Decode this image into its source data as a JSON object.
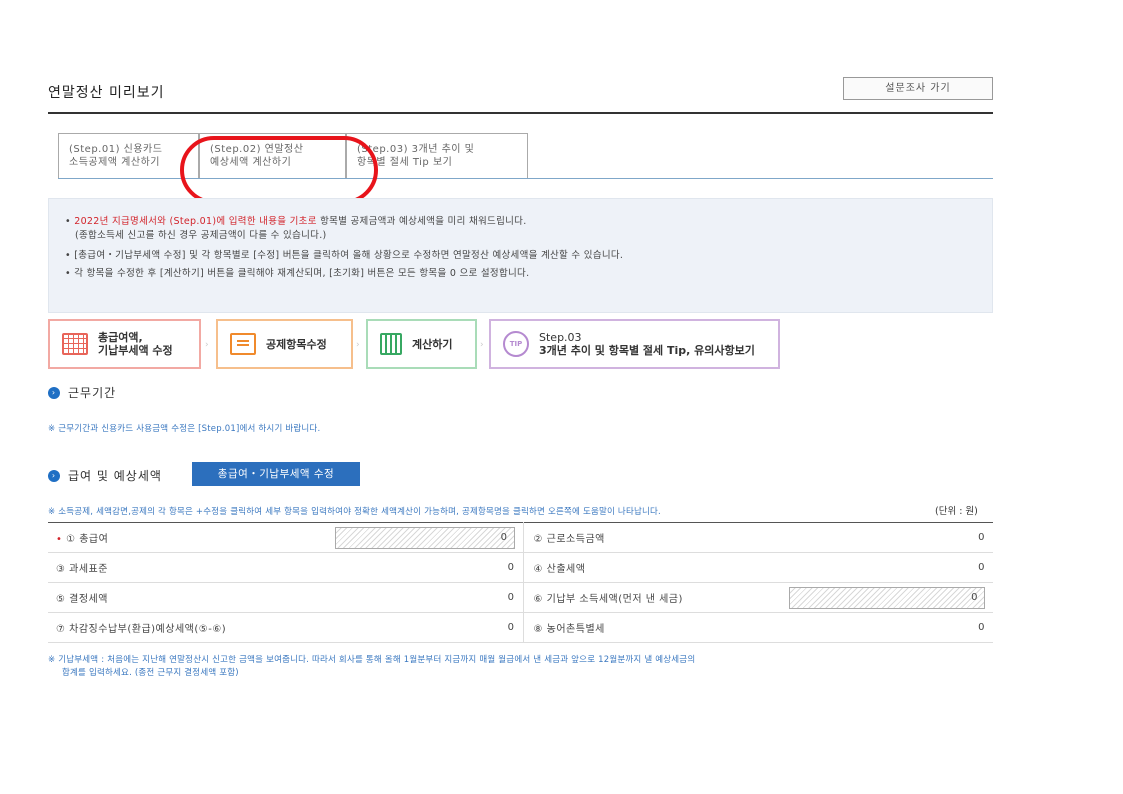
{
  "header": {
    "title": "연말정산 미리보기",
    "survey_button": "설문조사 가기"
  },
  "tabs": [
    {
      "line1": "(Step.01) 신용카드",
      "line2": "소득공제액 계산하기"
    },
    {
      "line1": "(Step.02) 연말정산",
      "line2": "예상세액 계산하기"
    },
    {
      "line1": "(Step.03) 3개년 추이 및",
      "line2": "항목별 절세 Tip 보기"
    }
  ],
  "info": {
    "line1_red": "2022년 지급명세서와 (Step.01)에 입력한 내용을 기초로",
    "line1_rest": " 항목별 공제금액과 예상세액을 미리 채워드립니다.",
    "line1_sub": "(종합소득세 신고를 하신 경우 공제금액이 다를 수 있습니다.)",
    "line2": "[총급여・기납부세액 수정] 및 각 항목별로 [수정] 버튼을 클릭하여 올해 상황으로 수정하면 연말정산 예상세액을 계산할 수 있습니다.",
    "line3": "각 항목을 수정한 후 [계산하기] 버튼을 클릭해야 재계산되며, [초기화] 버튼은 모든 항목을 0 으로 설정합니다."
  },
  "steps": [
    {
      "line1": "총급여액,",
      "line2": "기납부세액 수정"
    },
    {
      "line1": "공제항목수정",
      "line2": ""
    },
    {
      "line1": "계산하기",
      "line2": ""
    },
    {
      "line1": "Step.03",
      "line2": "3개년 추이 및 항목별 절세 Tip, 유의사항보기",
      "icon_text": "TIP"
    }
  ],
  "work_period": {
    "title": "근무기간",
    "note": "※ 근무기간과 신용카드 사용금액 수정은 [Step.01]에서 하시기 바랍니다."
  },
  "salary": {
    "title": "급여 및 예상세액",
    "edit_button": "총급여・기납부세액 수정",
    "note": "※ 소득공제, 세액감면,공제의 각 항목은 +수정을 클릭하여 세부 항목을 입력하여야 정확한 세액계산이 가능하며, 공제항목명을 클릭하면 오른쪽에 도움말이 나타납니다.",
    "unit": "(단위 : 원)"
  },
  "table": [
    {
      "l1": "① 총급여",
      "v1": "0",
      "l2": "② 근로소득금액",
      "v2": "0"
    },
    {
      "l1": "③ 과세표준",
      "v1": "0",
      "l2": "④ 산출세액",
      "v2": "0"
    },
    {
      "l1": "⑤ 결정세액",
      "v1": "0",
      "l2": "⑥ 기납부 소득세액(먼저 낸 세금)",
      "v2": "0"
    },
    {
      "l1": "⑦ 차감징수납부(환급)예상세액(⑤-⑥)",
      "v1": "0",
      "l2": "⑧ 농어촌특별세",
      "v2": "0"
    }
  ],
  "footnote": {
    "line1": "※ 기납부세액 : 처음에는 지난해 연말정산시 신고한 금액을 보여줍니다. 따라서 회사를 통해 올해 1월분부터 지금까지 매월 월급에서 낸 세금과 앞으로 12월분까지 낼 예상세금의",
    "line2": "합계를 입력하세요. (종전 근무지 결정세액 포함)"
  },
  "colors": {
    "accent_blue": "#2c6fbd",
    "highlight_red": "#e8141b"
  }
}
